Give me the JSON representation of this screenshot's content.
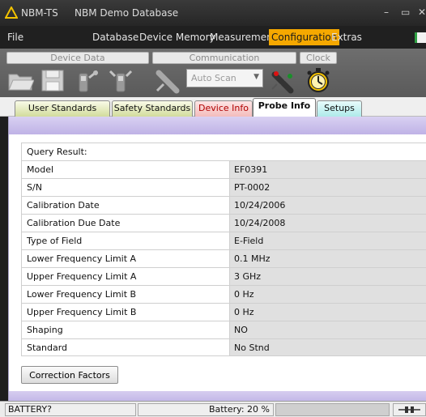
{
  "window": {
    "app_name": "NBM-TS",
    "database_name": "NBM Demo Database",
    "minimize_glyph": "–",
    "restore_glyph": "▭",
    "close_glyph": "✕"
  },
  "menu": {
    "items": [
      "File",
      "Database",
      "Device Memory",
      "Measurement",
      "Configuration",
      "Extras"
    ],
    "active": "Configuration",
    "accent_color": "#f5a800"
  },
  "toolbar": {
    "groups": {
      "device_data": "Device Data",
      "communication": "Communication",
      "clock": "Clock"
    },
    "auto_scan": {
      "value": "Auto Scan"
    },
    "icons": [
      "open-folder-icon",
      "save-disk-icon",
      "read-device-icon",
      "write-device-icon",
      "disconnected-plug-icon",
      "connect-plug-icon",
      "stopwatch-icon"
    ]
  },
  "tabs": [
    {
      "label": "User Standards"
    },
    {
      "label": "Safety Standards"
    },
    {
      "label": "Device Info"
    },
    {
      "label": "Probe Info",
      "active": true
    },
    {
      "label": "Setups"
    }
  ],
  "probe_info": {
    "query_label": "Query Result:",
    "rows": [
      {
        "label": "Model",
        "value": "EF0391"
      },
      {
        "label": "S/N",
        "value": "PT-0002"
      },
      {
        "label": "Calibration Date",
        "value": "10/24/2006"
      },
      {
        "label": "Calibration Due Date",
        "value": "10/24/2008"
      },
      {
        "label": "Type of Field",
        "value": "E-Field"
      },
      {
        "label": "Lower Frequency Limit A",
        "value": "0.1 MHz"
      },
      {
        "label": "Upper Frequency Limit A",
        "value": "3 GHz"
      },
      {
        "label": "Lower Frequency Limit B",
        "value": "0 Hz"
      },
      {
        "label": "Upper Frequency Limit B",
        "value": "0 Hz"
      },
      {
        "label": "Shaping",
        "value": "NO"
      },
      {
        "label": "Standard",
        "value": "No Stnd"
      }
    ],
    "correction_button": "Correction Factors"
  },
  "status": {
    "battery_state": "BATTERY?",
    "battery_text": "Battery: 20 %"
  }
}
